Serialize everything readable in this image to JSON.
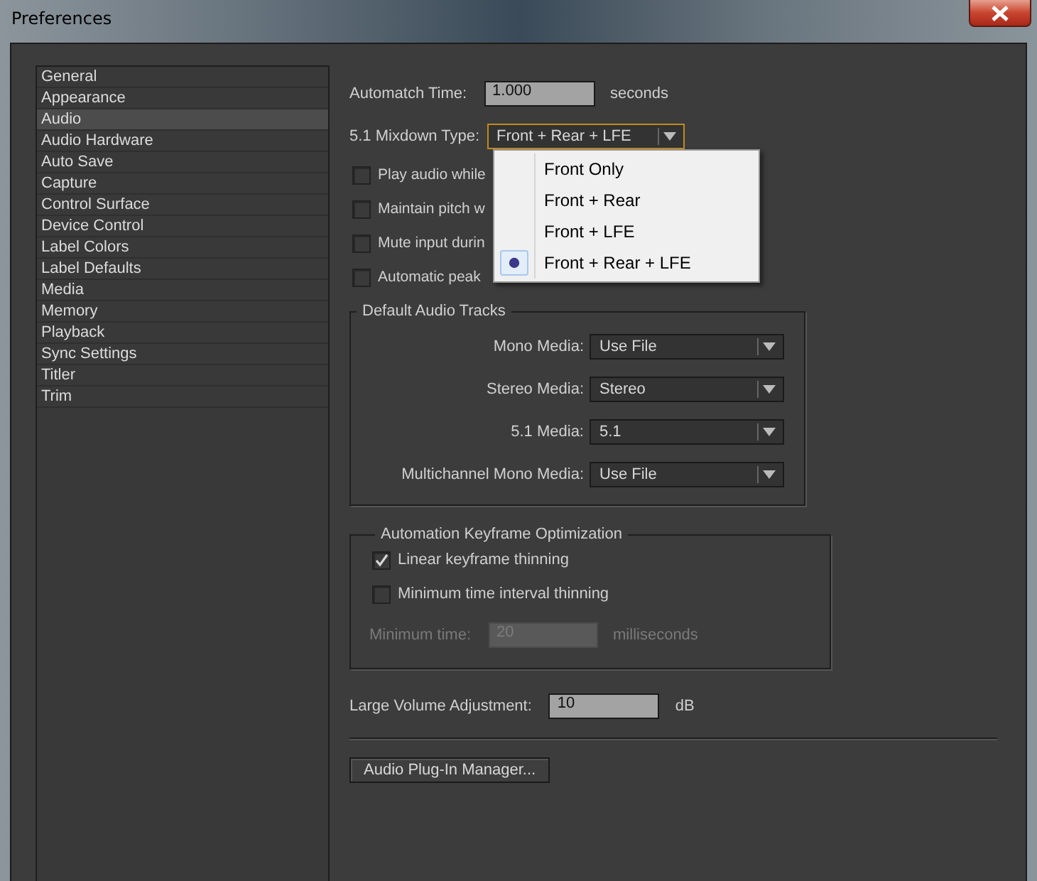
{
  "window": {
    "title": "Preferences"
  },
  "sidebar": {
    "items": [
      {
        "label": "General",
        "selected": false
      },
      {
        "label": "Appearance",
        "selected": false
      },
      {
        "label": "Audio",
        "selected": true
      },
      {
        "label": "Audio Hardware",
        "selected": false
      },
      {
        "label": "Auto Save",
        "selected": false
      },
      {
        "label": "Capture",
        "selected": false
      },
      {
        "label": "Control Surface",
        "selected": false
      },
      {
        "label": "Device Control",
        "selected": false
      },
      {
        "label": "Label Colors",
        "selected": false
      },
      {
        "label": "Label Defaults",
        "selected": false
      },
      {
        "label": "Media",
        "selected": false
      },
      {
        "label": "Memory",
        "selected": false
      },
      {
        "label": "Playback",
        "selected": false
      },
      {
        "label": "Sync Settings",
        "selected": false
      },
      {
        "label": "Titler",
        "selected": false
      },
      {
        "label": "Trim",
        "selected": false
      }
    ]
  },
  "automatch": {
    "label": "Automatch Time:",
    "value": "1.000",
    "unit": "seconds"
  },
  "mixdown": {
    "label": "5.1 Mixdown Type:",
    "value": "Front + Rear + LFE",
    "expanded": true,
    "options": [
      {
        "label": "Front Only",
        "selected": false
      },
      {
        "label": "Front + Rear",
        "selected": false
      },
      {
        "label": "Front + LFE",
        "selected": false
      },
      {
        "label": "Front + Rear + LFE",
        "selected": true
      }
    ]
  },
  "checkboxes": [
    {
      "label": "Play audio while",
      "checked": false
    },
    {
      "label": "Maintain pitch w",
      "checked": false
    },
    {
      "label": "Mute input durin",
      "checked": false
    },
    {
      "label": "Automatic peak",
      "checked": false
    }
  ],
  "default_audio_tracks": {
    "title": "Default Audio Tracks",
    "rows": [
      {
        "label": "Mono Media:",
        "value": "Use File"
      },
      {
        "label": "Stereo Media:",
        "value": "Stereo"
      },
      {
        "label": "5.1 Media:",
        "value": "5.1"
      },
      {
        "label": "Multichannel Mono Media:",
        "value": "Use File"
      }
    ]
  },
  "automation": {
    "title": "Automation Keyframe Optimization",
    "options": [
      {
        "label": "Linear keyframe thinning",
        "checked": true
      },
      {
        "label": "Minimum time interval thinning",
        "checked": false
      }
    ],
    "minimum_time": {
      "label": "Minimum time:",
      "value": "20",
      "unit": "milliseconds",
      "disabled": true
    }
  },
  "large_volume": {
    "label": "Large Volume Adjustment:",
    "value": "10",
    "unit": "dB"
  },
  "plugin_button": {
    "label": "Audio Plug-In Manager..."
  }
}
